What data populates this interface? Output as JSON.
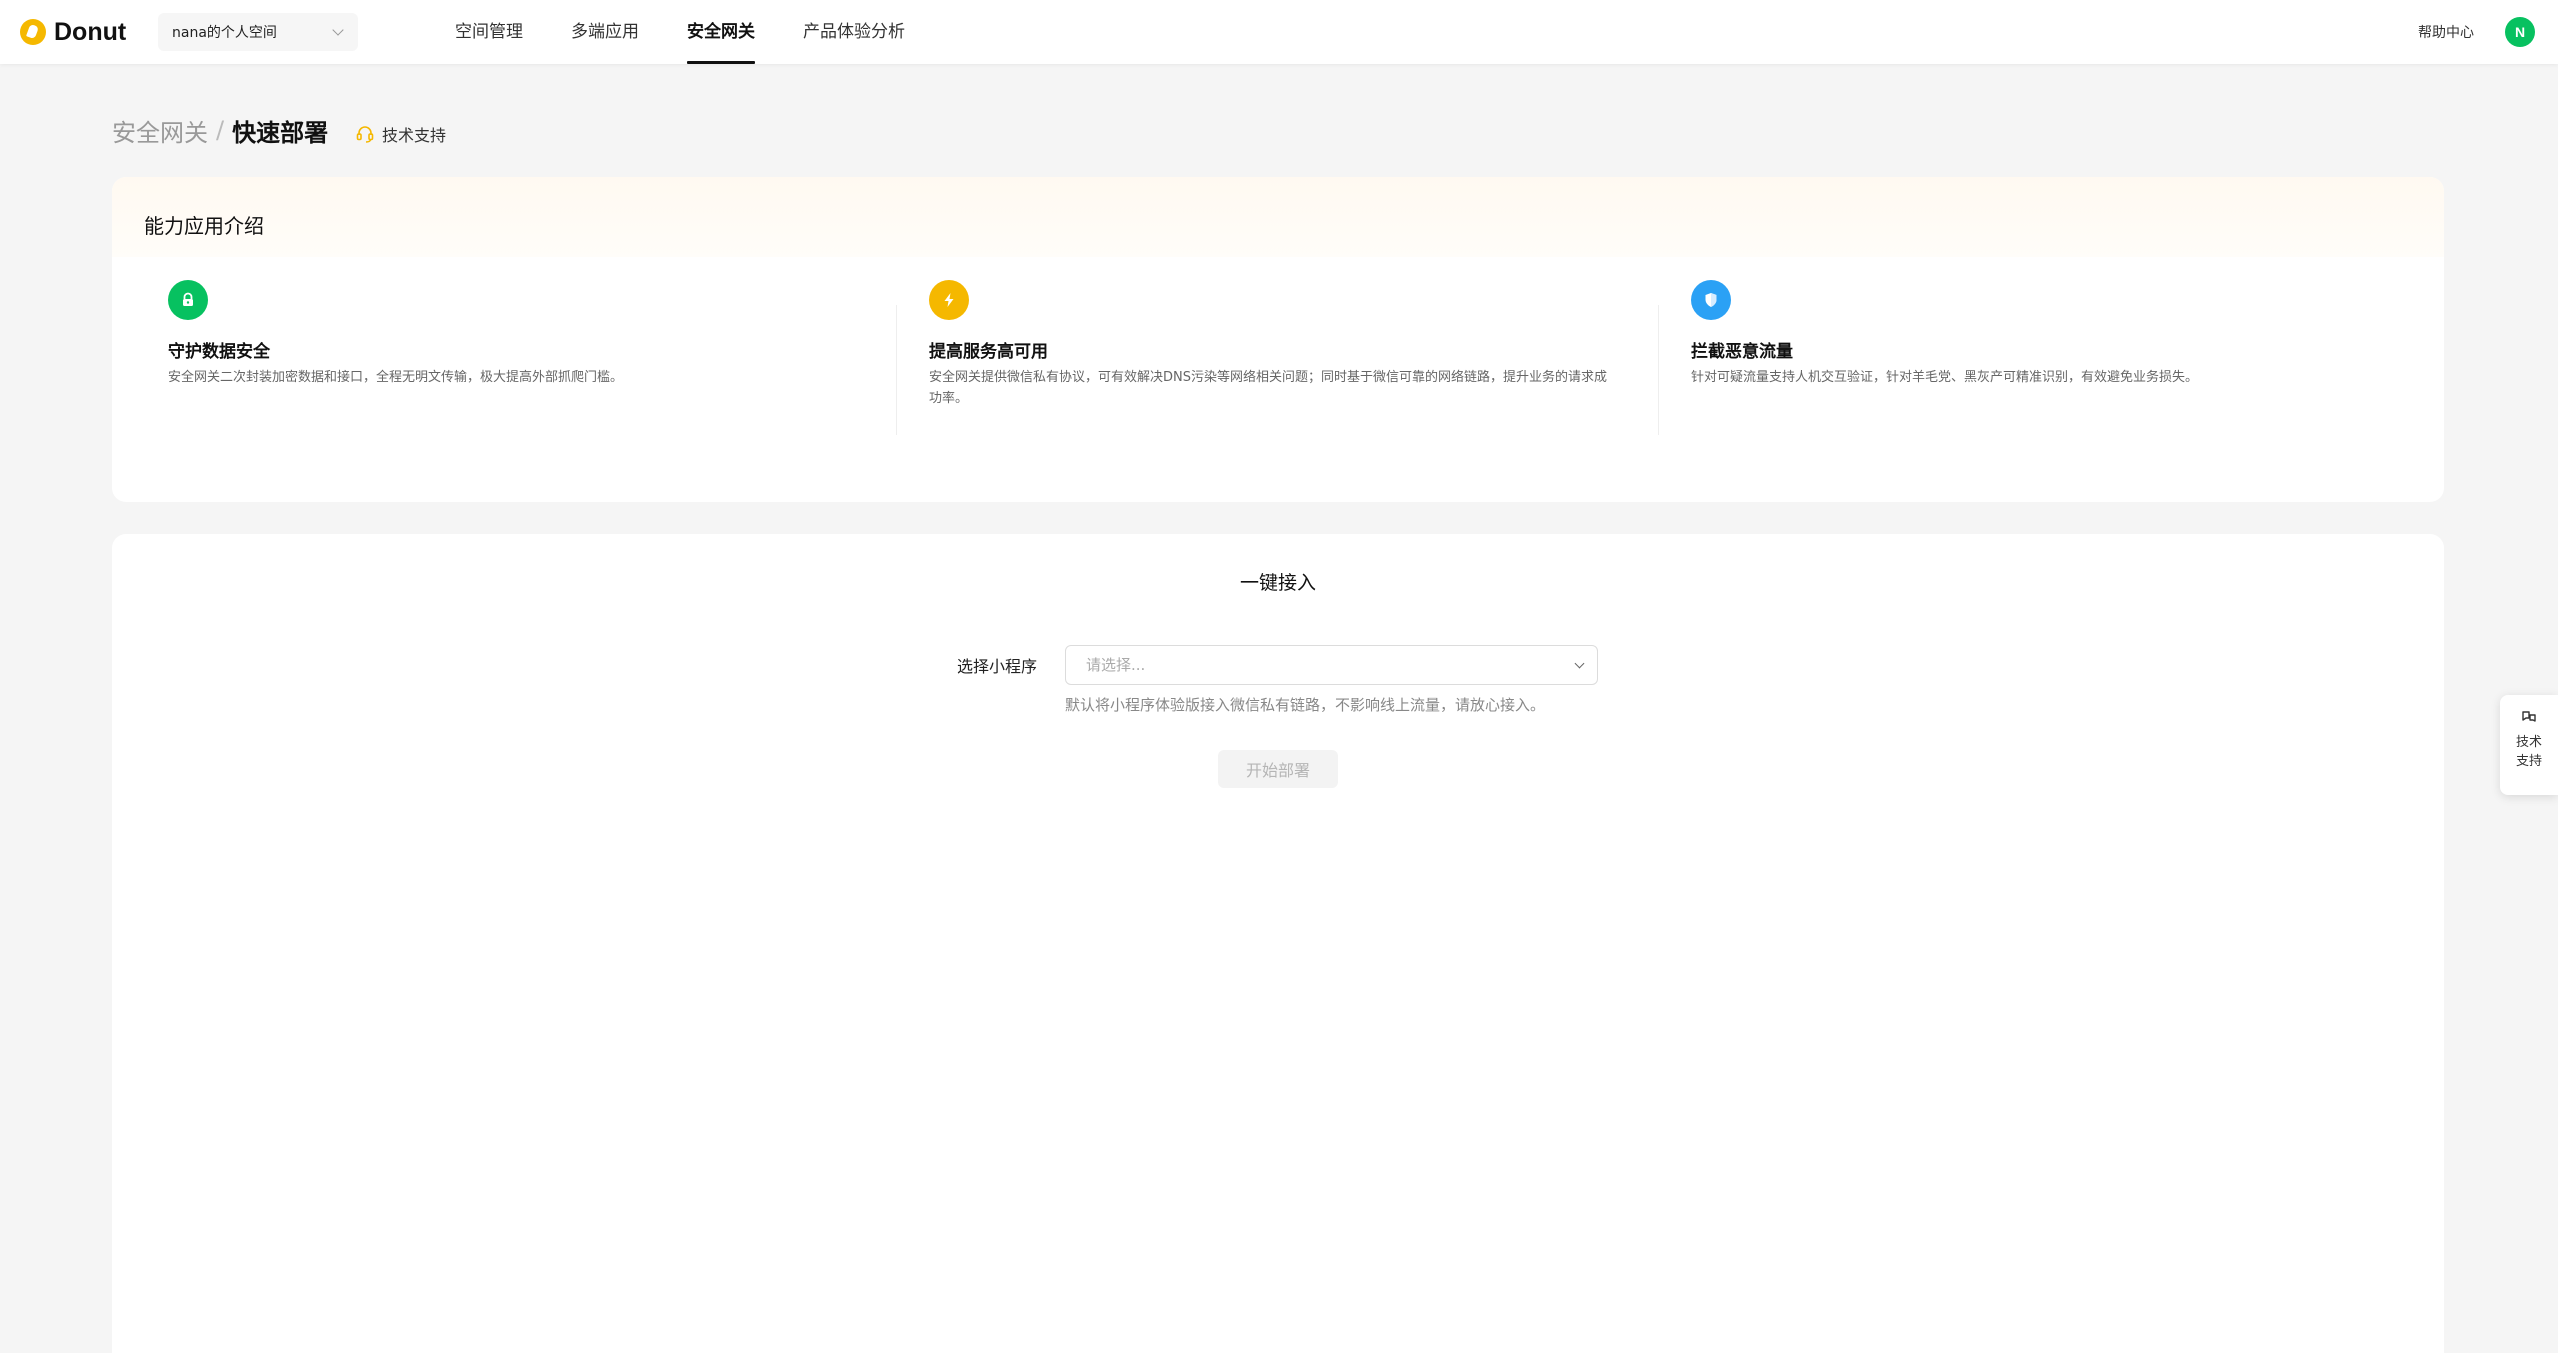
{
  "header": {
    "brand": "Donut",
    "space_selector": {
      "value": "nana的个人空间"
    },
    "nav": [
      {
        "label": "空间管理",
        "active": false
      },
      {
        "label": "多端应用",
        "active": false
      },
      {
        "label": "安全网关",
        "active": true
      },
      {
        "label": "产品体验分析",
        "active": false
      }
    ],
    "help": "帮助中心",
    "avatar_initial": "N"
  },
  "breadcrumb": {
    "parent": "安全网关",
    "separator": "/",
    "current": "快速部署"
  },
  "support_link": "技术支持",
  "intro": {
    "title": "能力应用介绍",
    "features": [
      {
        "title": "守护数据安全",
        "desc": "安全网关二次封装加密数据和接口，全程无明文传输，极大提高外部抓爬门槛。",
        "icon": "lock-icon",
        "color": "#07c160"
      },
      {
        "title": "提高服务高可用",
        "desc": "安全网关提供微信私有协议，可有效解决DNS污染等网络相关问题；同时基于微信可靠的网络链路，提升业务的请求成功率。",
        "icon": "lightning-icon",
        "color": "#f5b800"
      },
      {
        "title": "拦截恶意流量",
        "desc": "针对可疑流量支持人机交互验证，针对羊毛党、黑灰产可精准识别，有效避免业务损失。",
        "icon": "shield-icon",
        "color": "#2ba1f5"
      }
    ]
  },
  "access": {
    "title": "一键接入",
    "label": "选择小程序",
    "placeholder": "请选择...",
    "hint": "默认将小程序体验版接入微信私有链路，不影响线上流量，请放心接入。",
    "button": "开始部署"
  },
  "float_support": {
    "label": "技术支持"
  }
}
